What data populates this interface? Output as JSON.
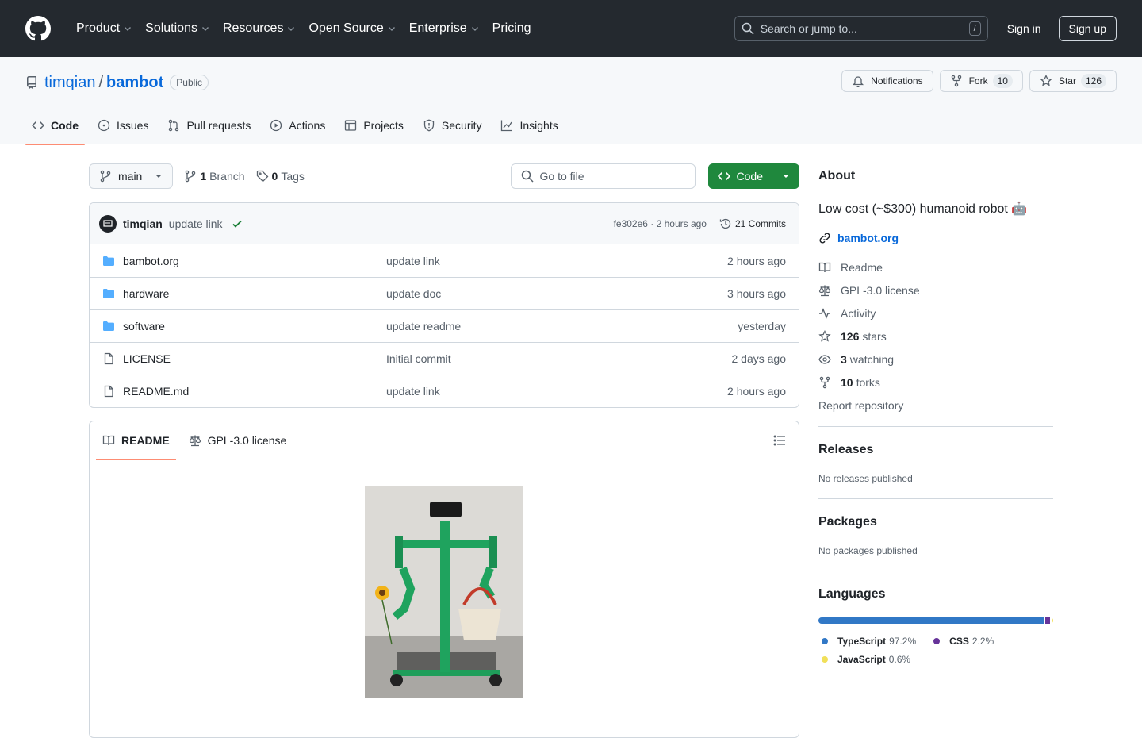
{
  "header": {
    "nav": [
      {
        "label": "Product",
        "has_menu": true
      },
      {
        "label": "Solutions",
        "has_menu": true
      },
      {
        "label": "Resources",
        "has_menu": true
      },
      {
        "label": "Open Source",
        "has_menu": true
      },
      {
        "label": "Enterprise",
        "has_menu": true
      },
      {
        "label": "Pricing",
        "has_menu": false
      }
    ],
    "search_placeholder": "Search or jump to...",
    "search_shortcut": "/",
    "signin": "Sign in",
    "signup": "Sign up"
  },
  "repo": {
    "owner": "timqian",
    "separator": "/",
    "name": "bambot",
    "visibility": "Public",
    "notifications_label": "Notifications",
    "fork_label": "Fork",
    "fork_count": "10",
    "star_label": "Star",
    "star_count": "126",
    "tabs": [
      {
        "label": "Code",
        "icon": "code-icon",
        "active": true
      },
      {
        "label": "Issues",
        "icon": "issue-icon",
        "active": false
      },
      {
        "label": "Pull requests",
        "icon": "pull-request-icon",
        "active": false
      },
      {
        "label": "Actions",
        "icon": "play-icon",
        "active": false
      },
      {
        "label": "Projects",
        "icon": "table-icon",
        "active": false
      },
      {
        "label": "Security",
        "icon": "shield-icon",
        "active": false
      },
      {
        "label": "Insights",
        "icon": "graph-icon",
        "active": false
      }
    ]
  },
  "toolbar": {
    "branch": "main",
    "branch_count": "1",
    "branch_label": "Branch",
    "tag_count": "0",
    "tag_label": "Tags",
    "goto_placeholder": "Go to file",
    "code_button": "Code"
  },
  "commit": {
    "author": "timqian",
    "message": "update link",
    "hash": "fe302e6",
    "time": "2 hours ago",
    "hash_time": "fe302e6 · 2 hours ago",
    "commits_label": "21 Commits"
  },
  "files": [
    {
      "name": "bambot.org",
      "type": "folder",
      "message": "update link",
      "time": "2 hours ago"
    },
    {
      "name": "hardware",
      "type": "folder",
      "message": "update doc",
      "time": "3 hours ago"
    },
    {
      "name": "software",
      "type": "folder",
      "message": "update readme",
      "time": "yesterday"
    },
    {
      "name": "LICENSE",
      "type": "file",
      "message": "Initial commit",
      "time": "2 days ago"
    },
    {
      "name": "README.md",
      "type": "file",
      "message": "update link",
      "time": "2 hours ago"
    }
  ],
  "readme": {
    "tabs": [
      {
        "label": "README",
        "icon": "book-icon",
        "active": true
      },
      {
        "label": "GPL-3.0 license",
        "icon": "law-icon",
        "active": false
      }
    ]
  },
  "about": {
    "heading": "About",
    "description": "Low cost (~$300) humanoid robot 🤖",
    "website": "bambot.org",
    "items": [
      {
        "icon": "book-icon",
        "bold": "",
        "label": "Readme"
      },
      {
        "icon": "law-icon",
        "bold": "",
        "label": "GPL-3.0 license"
      },
      {
        "icon": "pulse-icon",
        "bold": "",
        "label": "Activity"
      },
      {
        "icon": "star-icon",
        "bold": "126",
        "label": "stars"
      },
      {
        "icon": "eye-icon",
        "bold": "3",
        "label": "watching"
      },
      {
        "icon": "fork-icon",
        "bold": "10",
        "label": "forks"
      }
    ],
    "report": "Report repository"
  },
  "releases": {
    "heading": "Releases",
    "empty": "No releases published"
  },
  "packages": {
    "heading": "Packages",
    "empty": "No packages published"
  },
  "languages": {
    "heading": "Languages",
    "items": [
      {
        "name": "TypeScript",
        "percent": "97.2%",
        "value": 97.2,
        "color": "#3178c6"
      },
      {
        "name": "CSS",
        "percent": "2.2%",
        "value": 2.2,
        "color": "#663399"
      },
      {
        "name": "JavaScript",
        "percent": "0.6%",
        "value": 0.6,
        "color": "#f1e05a"
      }
    ]
  }
}
